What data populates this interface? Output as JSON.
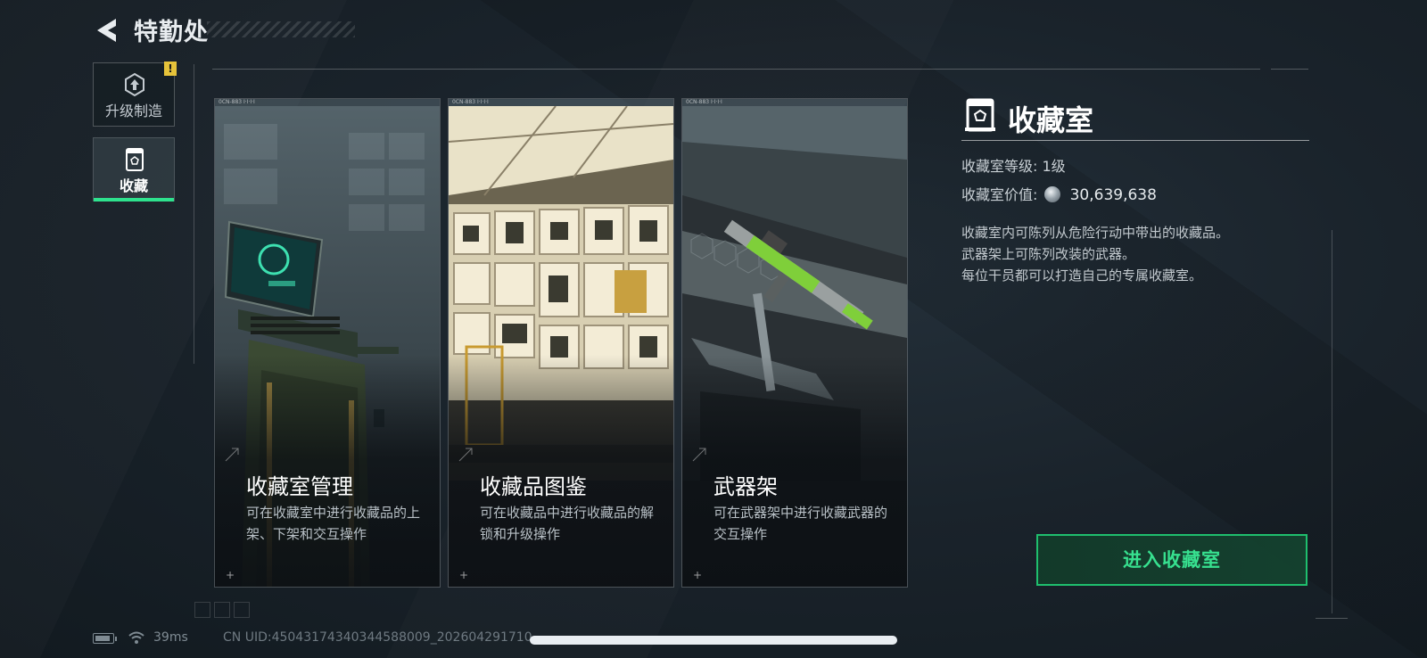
{
  "header": {
    "title": "特勤处",
    "back_icon": "back-arrow-icon"
  },
  "sidebar": {
    "items": [
      {
        "label": "升级制造",
        "icon": "upgrade-icon",
        "active": false,
        "alert": "!"
      },
      {
        "label": "收藏",
        "icon": "collection-icon",
        "active": true
      }
    ]
  },
  "cards": [
    {
      "title": "收藏室管理",
      "desc": "可在收藏室中进行收藏品的上架、下架和交互操作",
      "code": "0CN-883 Ⅰ·Ⅰ·Ⅰ·Ⅰ"
    },
    {
      "title": "收藏品图鉴",
      "desc": "可在收藏品中进行收藏品的解锁和升级操作",
      "code": "0CN-883 Ⅰ·Ⅰ·Ⅰ·Ⅰ"
    },
    {
      "title": "武器架",
      "desc": "可在武器架中进行收藏武器的交互操作",
      "code": "0CN-883 Ⅰ·Ⅰ·Ⅰ·Ⅰ"
    }
  ],
  "panel": {
    "title": "收藏室",
    "level_label": "收藏室等级:",
    "level_value": "1级",
    "value_label": "收藏室价值:",
    "value_amount": "30,639,638",
    "desc_lines": [
      "收藏室内可陈列从危险行动中带出的收藏品。",
      "武器架上可陈列改装的武器。",
      "每位干员都可以打造自己的专属收藏室。"
    ],
    "enter_button": "进入收藏室"
  },
  "status": {
    "ping": "39ms",
    "uid": "CN UID:4504317434034458800​9_202604291710"
  },
  "colors": {
    "accent": "#2ee28e",
    "button_text": "#37e08f",
    "alert": "#e6c33a"
  }
}
